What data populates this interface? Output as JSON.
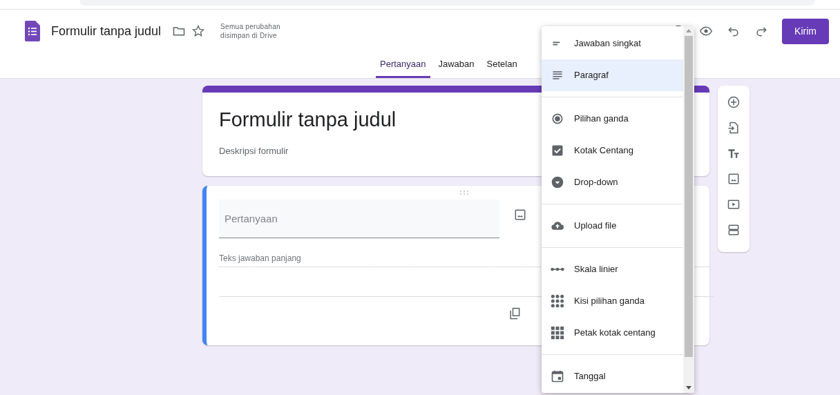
{
  "header": {
    "title": "Formulir tanpa judul",
    "save_status": "Semua perubahan disimpan di Drive",
    "send_button": "Kirim"
  },
  "tabs": [
    {
      "label": "Pertanyaan",
      "selected": true
    },
    {
      "label": "Jawaban",
      "selected": false
    },
    {
      "label": "Setelan",
      "selected": false
    }
  ],
  "form": {
    "title": "Formulir tanpa judul",
    "description": "Deskripsi formulir"
  },
  "question": {
    "placeholder": "Pertanyaan",
    "answer_hint": "Teks jawaban panjang"
  },
  "type_menu": {
    "groups": [
      [
        {
          "label": "Jawaban singkat",
          "kind": "short",
          "selected": false
        },
        {
          "label": "Paragraf",
          "kind": "paragraph",
          "selected": true
        }
      ],
      [
        {
          "label": "Pilihan ganda",
          "kind": "radio",
          "selected": false
        },
        {
          "label": "Kotak Centang",
          "kind": "checkbox",
          "selected": false
        },
        {
          "label": "Drop-down",
          "kind": "dropdown",
          "selected": false
        }
      ],
      [
        {
          "label": "Upload file",
          "kind": "upload",
          "selected": false
        }
      ],
      [
        {
          "label": "Skala linier",
          "kind": "scale",
          "selected": false
        },
        {
          "label": "Kisi pilihan ganda",
          "kind": "radiogrid",
          "selected": false
        },
        {
          "label": "Petak kotak centang",
          "kind": "checkgrid",
          "selected": false
        }
      ],
      [
        {
          "label": "Tanggal",
          "kind": "date",
          "selected": false
        }
      ]
    ]
  }
}
